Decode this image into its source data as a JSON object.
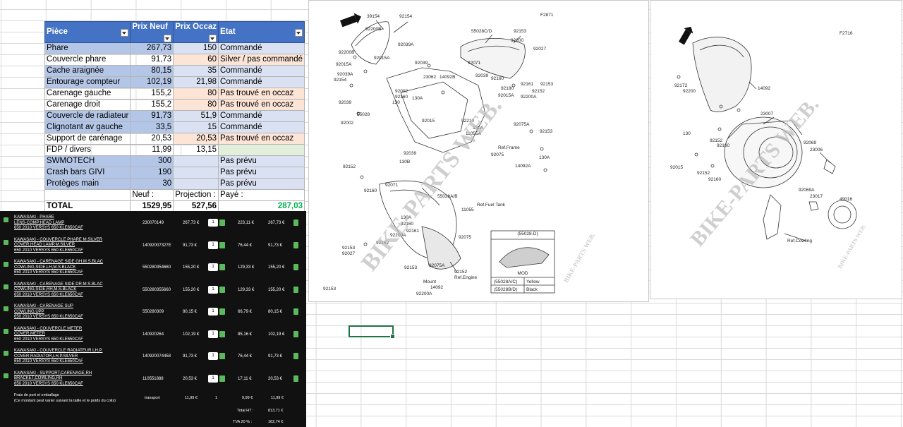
{
  "sheet": {
    "headers": [
      "Pièce",
      "Prix Neuf",
      "Prix Occaz",
      "Etat"
    ],
    "rows": [
      {
        "piece": "Phare",
        "neuf": "267,73",
        "occaz": "150",
        "etat": "Commandé",
        "style": "b"
      },
      {
        "piece": "Couvercle phare",
        "neuf": "91,73",
        "occaz": "60",
        "etat": "Silver / pas commandé",
        "style": "o"
      },
      {
        "piece": "Cache araignée",
        "neuf": "80,15",
        "occaz": "35",
        "etat": "Commandé",
        "style": "b"
      },
      {
        "piece": "Entourage compteur",
        "neuf": "102,19",
        "occaz": "21,98",
        "etat": "Commandé",
        "style": "b"
      },
      {
        "piece": "Carenage gauche",
        "neuf": "155,2",
        "occaz": "80",
        "etat": "Pas trouvé en occaz",
        "style": "o"
      },
      {
        "piece": "Carenage droit",
        "neuf": "155,2",
        "occaz": "80",
        "etat": "Pas trouvé en occaz",
        "style": "o"
      },
      {
        "piece": "Couvercle de radiateur",
        "neuf": "91,73",
        "occaz": "51,9",
        "etat": "Commandé",
        "style": "b"
      },
      {
        "piece": "Clignotant av gauche",
        "neuf": "33,5",
        "occaz": "15",
        "etat": "Commandé",
        "style": "b"
      },
      {
        "piece": "Support de carénage",
        "neuf": "20,53",
        "occaz": "20,53",
        "etat": "Pas trouvé en occaz",
        "style": "o"
      },
      {
        "piece": "FDP / divers",
        "neuf": "11,99",
        "occaz": "13,15",
        "etat": "",
        "style": "g"
      },
      {
        "piece": "SWMOTECH",
        "neuf": "300",
        "occaz": "",
        "etat": "Pas prévu",
        "style": "b"
      },
      {
        "piece": "Crash bars GIVI",
        "neuf": "190",
        "occaz": "",
        "etat": "Pas prévu",
        "style": "b"
      },
      {
        "piece": "Protèges main",
        "neuf": "30",
        "occaz": "",
        "etat": "Pas prévu",
        "style": "b"
      }
    ],
    "summary_labels": [
      "Neuf :",
      "Projection :",
      "Payé :"
    ],
    "total_label": "TOTAL",
    "total_neuf": "1529,95",
    "total_projection": "527,56",
    "total_paye": "287,03"
  },
  "order": {
    "items": [
      {
        "l1": "KAWASAKI - PHARE",
        "l2": "LENS-COMP,HEAD LAMP",
        "l3": "650 2010 VERSYS 650 KLE650CAF",
        "ref": "230070149",
        "unit": "267,73 €",
        "qty": "1",
        "ht": "223,11 €",
        "ttc": "267,73 €"
      },
      {
        "l1": "KAWASAKI - COUVERCLE PHARE M.SILVER",
        "l2": "COVER,HEAD LAMP,M.SILVER",
        "l3": "650 2010 VERSYS 650 KLE650CAF",
        "ref": "14092007327E",
        "unit": "91,73 €",
        "qty": "1",
        "ht": "76,44 €",
        "ttc": "91,73 €"
      },
      {
        "l1": "KAWASAKI - CARENAGE SIDE GH.M.S.BLAC",
        "l2": "COWLING,SIDE,LH,M.S.BLACK",
        "l3": "650 2010 VERSYS 650 KLE650CAF",
        "ref": "550280354660",
        "unit": "155,20 €",
        "qty": "1",
        "ht": "129,33 €",
        "ttc": "155,20 €"
      },
      {
        "l1": "KAWASAKI - CARENAGE SIDE DR.M.S.BLAC",
        "l2": "COWLING,SIDE,RH,M.S.BLACK",
        "l3": "650 2010 VERSYS 650 KLE650CAF",
        "ref": "550280355660",
        "unit": "155,20 €",
        "qty": "1",
        "ht": "129,33 €",
        "ttc": "155,20 €"
      },
      {
        "l1": "KAWASAKI - CARENAGE SUP",
        "l2": "COWLING,UPP",
        "l3": "650 2010 VERSYS 650 KLE650CAF",
        "ref": "550280309",
        "unit": "80,15 €",
        "qty": "1",
        "ht": "66,79 €",
        "ttc": "80,15 €"
      },
      {
        "l1": "KAWASAKI - COUVERCLE METER",
        "l2": "COVER,METER",
        "l3": "650 2010 VERSYS 650 KLE650CAF",
        "ref": "140920264",
        "unit": "102,19 €",
        "qty": "1",
        "ht": "85,16 €",
        "ttc": "102,19 €"
      },
      {
        "l1": "KAWASAKI - COUVERCLE RADIATEUR LH.P.",
        "l2": "COVER,RADIATOR,LH,P.SILVER",
        "l3": "650 2010 VERSYS 650 KLE650CAF",
        "ref": "140920074458",
        "unit": "91,73 €",
        "qty": "1",
        "ht": "76,44 €",
        "ttc": "91,73 €"
      },
      {
        "l1": "KAWASAKI - SUPPORT,CARENAGE,RH",
        "l2": "BRACKET,COWLING,RH",
        "l3": "650 2010 VERSYS 650 KLE650CAF",
        "ref": "110551888",
        "unit": "20,53 €",
        "qty": "1",
        "ht": "17,11 €",
        "ttc": "20,53 €"
      }
    ],
    "shipping": {
      "l1": "Frais de port et emballage",
      "l2": "(Ce montant peut varier suivant la taille et le poids du colis)",
      "type": "transport",
      "unit": "11,99 €",
      "qty": "1",
      "ht": "9,99 €",
      "ttc": "11,99 €"
    },
    "total_ht_label": "Total HT :",
    "total_ht": "813,71 €",
    "tva_label": "TVA 20 % :",
    "tva": "162,74 €"
  },
  "diagram1": {
    "code": "F2871",
    "watermark": "BIKE-PARTS WEB.",
    "small_watermark": "BIKE-PARTS WEB.",
    "legend_code": "(55028-D)",
    "legend_word": "MOD",
    "legend_rows": [
      [
        "(55028A/C)",
        "Yellow"
      ],
      [
        "(55028B/D)",
        "Black"
      ]
    ],
    "labels": [
      "39154",
      "92154",
      "92200B",
      "55028C/D",
      "92153",
      "92200",
      "92027",
      "92200B",
      "92039A",
      "92015A",
      "92015A",
      "92039",
      "92071",
      "92039A",
      "92154",
      "23062",
      "14092B",
      "92039",
      "92160",
      "92161",
      "92153",
      "92002",
      "92160",
      "130",
      "130A",
      "92180",
      "92152",
      "92015A",
      "92200A",
      "92039",
      "55028",
      "92015",
      "92210",
      "130A",
      "11055A",
      "92075A",
      "92153",
      "92002",
      "92039",
      "130B",
      "Ref.Frame",
      "92075",
      "130A",
      "92152",
      "92071",
      "92160",
      "14092A",
      "55028A/B",
      "Ref.Fuel Tank",
      "11055",
      "130A",
      "92160",
      "92161",
      "92200A",
      "92152",
      "92153",
      "92027",
      "92075",
      "92153",
      "92075A",
      "92152",
      "Ref.Engine",
      "Mount",
      "14092",
      "92200A",
      "92153"
    ]
  },
  "diagram2": {
    "code": "F2716",
    "watermark": "BIKE-PARTS WEB.",
    "small_watermark": "BIKE-PARTS WEB.",
    "labels": [
      "92172",
      "92200",
      "14092",
      "23007",
      "130",
      "92152",
      "92160",
      "92069",
      "23006",
      "92015",
      "92152",
      "92160",
      "92069A",
      "23017",
      "49016",
      "Ref.Cowling"
    ]
  }
}
